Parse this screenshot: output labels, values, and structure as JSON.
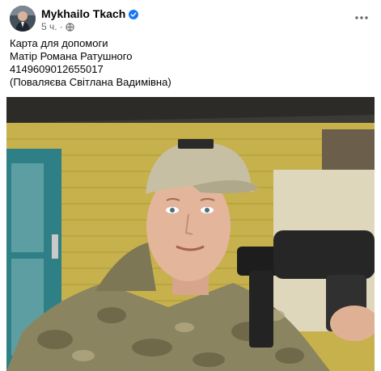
{
  "post": {
    "author": "Mykhailo Tkach",
    "time": "5 ч.",
    "separator": "·",
    "verified_icon": "verified-badge-icon",
    "privacy_icon": "globe-icon",
    "more_icon": "more-horizontal-icon",
    "text_lines": [
      "Карта для допомоги",
      "Матір Романа Ратушного",
      "4149609012655017",
      "(Поваляєва Світлана Вадимівна)"
    ]
  },
  "colors": {
    "accent": "#1877f2",
    "text": "#050505",
    "secondary": "#65676b"
  }
}
